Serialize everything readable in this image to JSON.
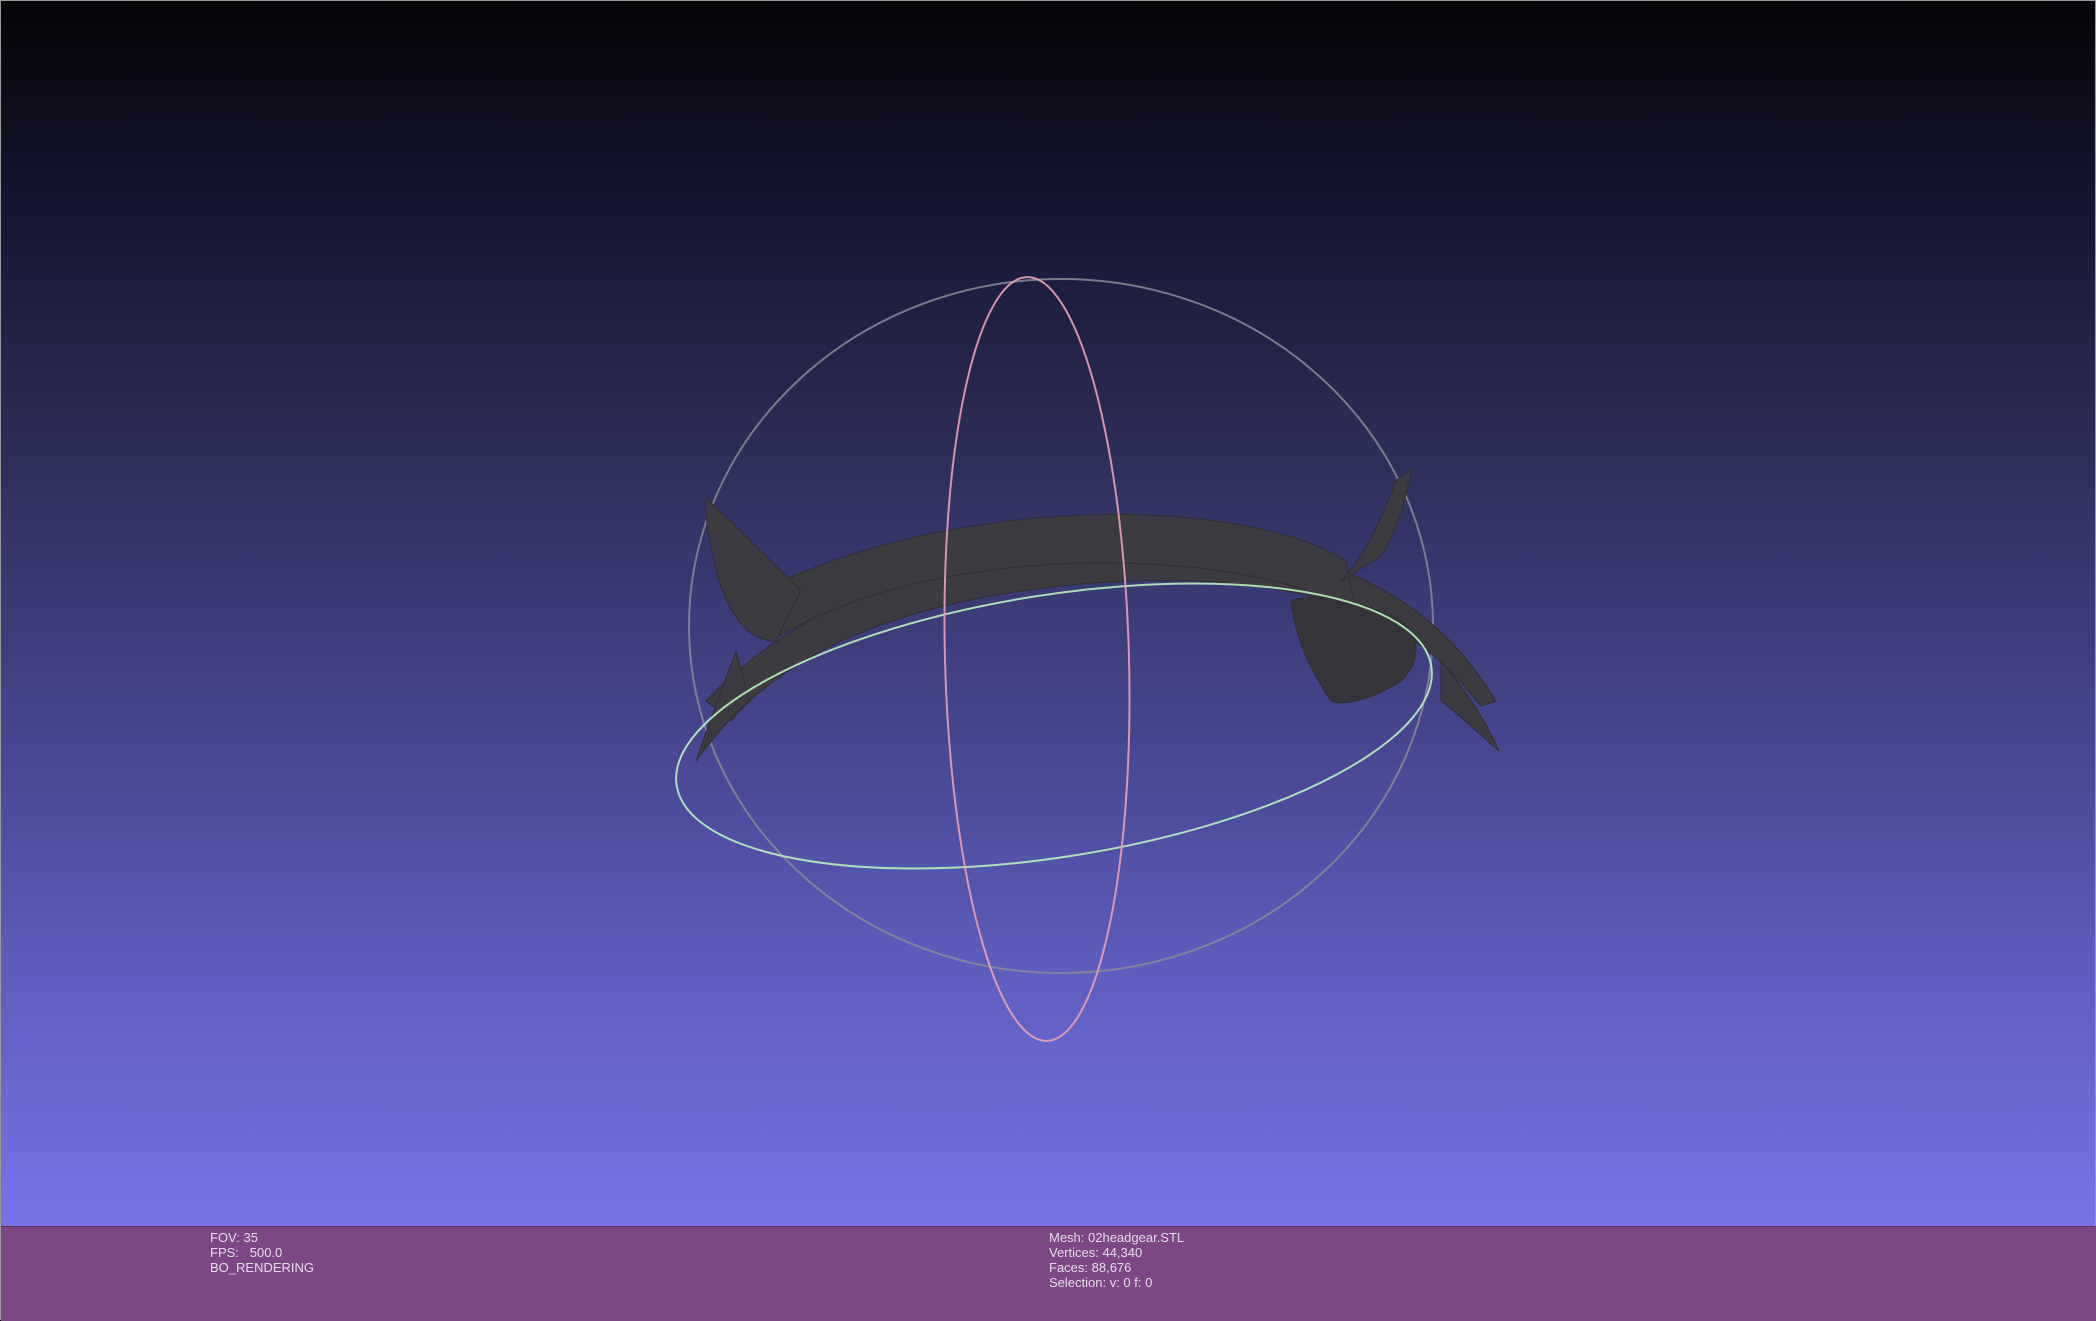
{
  "viewer": {
    "colors": {
      "background_top": "#050508",
      "background_bottom": "#7878ec",
      "mesh": "#3a3a3f",
      "info_bar": "#7d4685",
      "trackball_x": "#e8a0b4",
      "trackball_y": "#9a9aa8",
      "trackball_z": "#b8f0c0"
    }
  },
  "info_left": {
    "fov": "FOV: 35",
    "fps": "FPS:   500.0",
    "render_mode": "BO_RENDERING"
  },
  "info_right": {
    "mesh": "Mesh: 02headgear.STL",
    "vertices": "Vertices: 44,340",
    "faces": "Faces: 88,676",
    "selection": "Selection: v: 0 f: 0"
  }
}
